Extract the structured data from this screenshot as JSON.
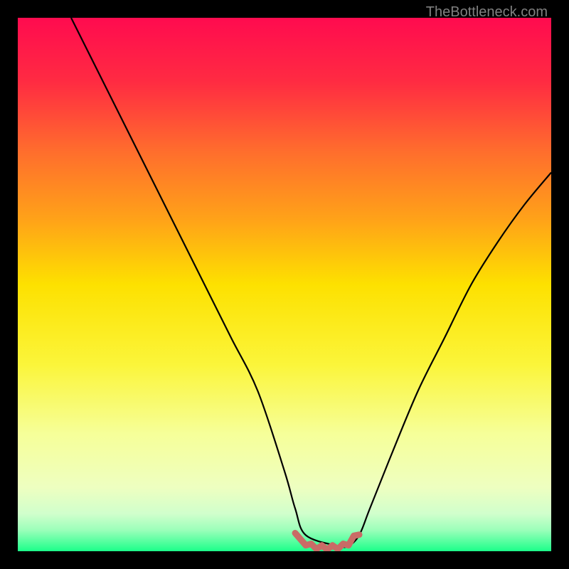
{
  "attribution": "TheBottleneck.com",
  "chart_data": {
    "type": "line",
    "title": "",
    "xlabel": "",
    "ylabel": "",
    "xlim": [
      0,
      100
    ],
    "ylim": [
      0,
      100
    ],
    "gradient_stops": [
      {
        "offset": 0,
        "color": "#ff0b4f"
      },
      {
        "offset": 25,
        "color": "#ff6d2d"
      },
      {
        "offset": 50,
        "color": "#fde100"
      },
      {
        "offset": 75,
        "color": "#f6ff99"
      },
      {
        "offset": 93,
        "color": "#e3ffd0"
      },
      {
        "offset": 100,
        "color": "#1cff8a"
      }
    ],
    "series": [
      {
        "name": "bottleneck-curve-black",
        "color": "#000000",
        "x": [
          10,
          15,
          20,
          25,
          30,
          35,
          40,
          45,
          50,
          52,
          54,
          60,
          62,
          64,
          66,
          70,
          75,
          80,
          85,
          90,
          95,
          100
        ],
        "y": [
          100,
          90,
          80,
          70,
          60,
          50,
          40,
          30,
          15,
          8,
          3,
          1,
          1,
          3,
          8,
          18,
          30,
          40,
          50,
          58,
          65,
          71
        ]
      },
      {
        "name": "optimal-zone-marker",
        "color": "#c96b66",
        "x": [
          52,
          54,
          55,
          56,
          57,
          58,
          59,
          60,
          61,
          62,
          63,
          64
        ],
        "y": [
          3,
          1.5,
          1,
          0.8,
          0.7,
          0.7,
          0.7,
          0.8,
          1,
          1.5,
          2.5,
          3.5
        ]
      }
    ]
  }
}
